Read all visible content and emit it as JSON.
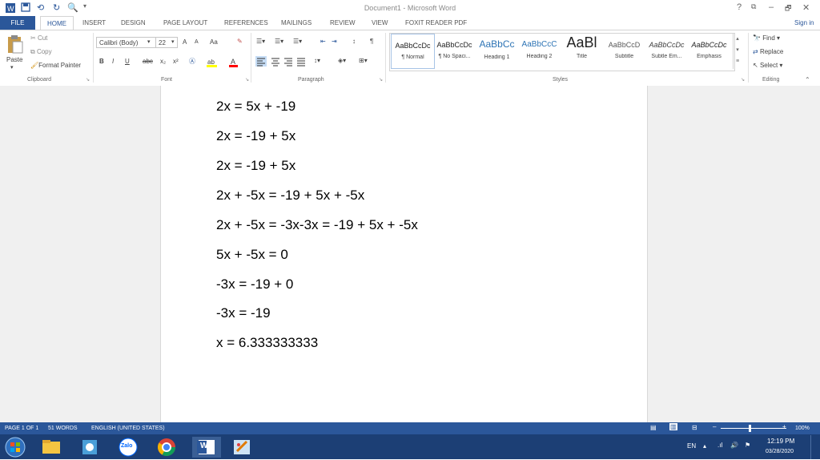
{
  "window": {
    "title": "Document1 - Microsoft Word",
    "signin": "Sign in",
    "help": "?",
    "minimize": "–",
    "restore": "🗗",
    "close": "✕"
  },
  "tabs": [
    "FILE",
    "HOME",
    "INSERT",
    "DESIGN",
    "PAGE LAYOUT",
    "REFERENCES",
    "MAILINGS",
    "REVIEW",
    "VIEW",
    "FOXIT READER PDF"
  ],
  "clipboard": {
    "paste": "Paste",
    "cut": "Cut",
    "copy": "Copy",
    "format_painter": "Format Painter",
    "label": "Clipboard"
  },
  "font": {
    "name": "Calibri (Body)",
    "size": "22",
    "grow": "A",
    "shrink": "A",
    "case": "Aa",
    "bold": "B",
    "italic": "I",
    "underline": "U",
    "strike": "abc",
    "subscript": "x₂",
    "superscript": "x²",
    "label": "Font"
  },
  "paragraph": {
    "label": "Paragraph"
  },
  "styles": {
    "label": "Styles",
    "items": [
      {
        "preview": "AaBbCcDc",
        "name": "¶ Normal"
      },
      {
        "preview": "AaBbCcDc",
        "name": "¶ No Spaci..."
      },
      {
        "preview": "AaBbCc",
        "name": "Heading 1"
      },
      {
        "preview": "AaBbCcC",
        "name": "Heading 2"
      },
      {
        "preview": "AaBl",
        "name": "Title"
      },
      {
        "preview": "AaBbCcD",
        "name": "Subtitle"
      },
      {
        "preview": "AaBbCcDc",
        "name": "Subtle Em..."
      },
      {
        "preview": "AaBbCcDc",
        "name": "Emphasis"
      }
    ]
  },
  "editing": {
    "find": "Find",
    "replace": "Replace",
    "select": "Select",
    "label": "Editing"
  },
  "document": {
    "lines": [
      "2x = 5x + -19",
      "2x = -19 + 5x",
      "2x = -19 + 5x",
      "2x + -5x = -19 + 5x + -5x",
      "2x + -5x = -3x-3x = -19 + 5x + -5x",
      "5x + -5x = 0",
      "-3x = -19 + 0",
      "-3x = -19",
      "x = 6.333333333"
    ]
  },
  "status": {
    "page": "PAGE 1 OF 1",
    "words": "51 WORDS",
    "language": "ENGLISH (UNITED STATES)",
    "zoom": "100%"
  },
  "taskbar": {
    "zalo": "Zalo",
    "word_icon": "W",
    "lang": "EN",
    "time": "12:19 PM",
    "date": "03/28/2020"
  },
  "colors": {
    "accent": "#2b579a",
    "taskbar": "#1c3f75"
  }
}
